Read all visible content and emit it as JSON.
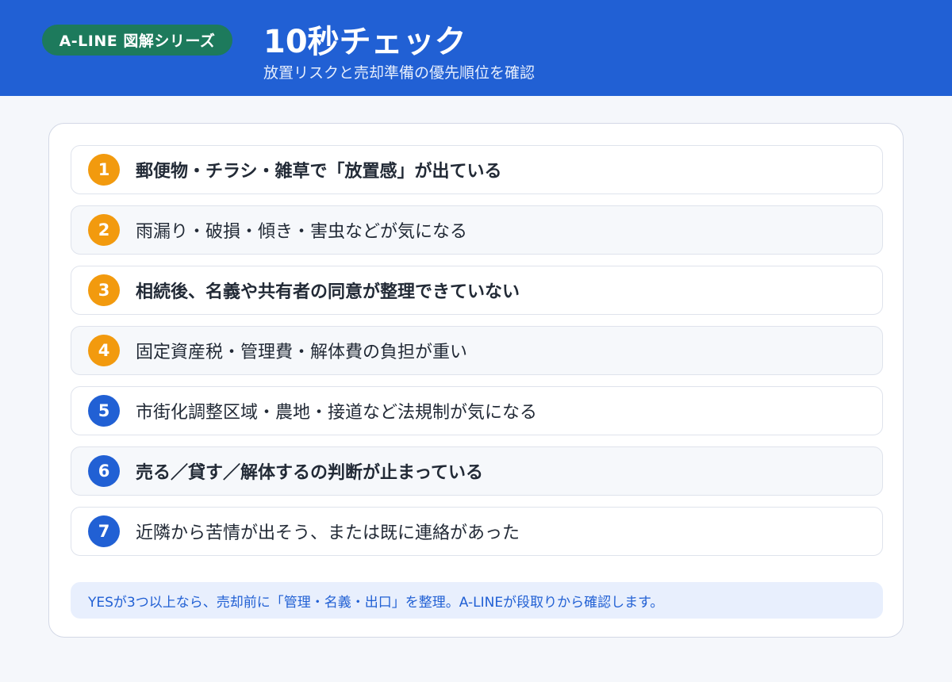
{
  "header": {
    "series_badge": "A-LINE 図解シリーズ",
    "title": "10秒チェック",
    "subtitle": "放置リスクと売却準備の優先順位を確認"
  },
  "checklist": [
    {
      "number": "1",
      "text": "郵便物・チラシ・雑草で「放置感」が出ている",
      "bold": true,
      "color": "#f29a0e"
    },
    {
      "number": "2",
      "text": "雨漏り・破損・傾き・害虫などが気になる",
      "bold": false,
      "color": "#f29a0e"
    },
    {
      "number": "3",
      "text": "相続後、名義や共有者の同意が整理できていない",
      "bold": true,
      "color": "#f29a0e"
    },
    {
      "number": "4",
      "text": "固定資産税・管理費・解体費の負担が重い",
      "bold": false,
      "color": "#f29a0e"
    },
    {
      "number": "5",
      "text": "市街化調整区域・農地・接道など法規制が気になる",
      "bold": false,
      "color": "#2160d4"
    },
    {
      "number": "6",
      "text": "売る／貸す／解体するの判断が止まっている",
      "bold": true,
      "color": "#2160d4"
    },
    {
      "number": "7",
      "text": "近隣から苦情が出そう、または既に連絡があった",
      "bold": false,
      "color": "#2160d4"
    }
  ],
  "footer_note": "YESが3つ以上なら、売却前に「管理・名義・出口」を整理。A-LINEが段取りから確認します。",
  "colors": {
    "header_blue": "#2160d4",
    "badge_green": "#1d7a5c",
    "number_orange": "#f29a0e",
    "number_blue": "#2160d4"
  }
}
